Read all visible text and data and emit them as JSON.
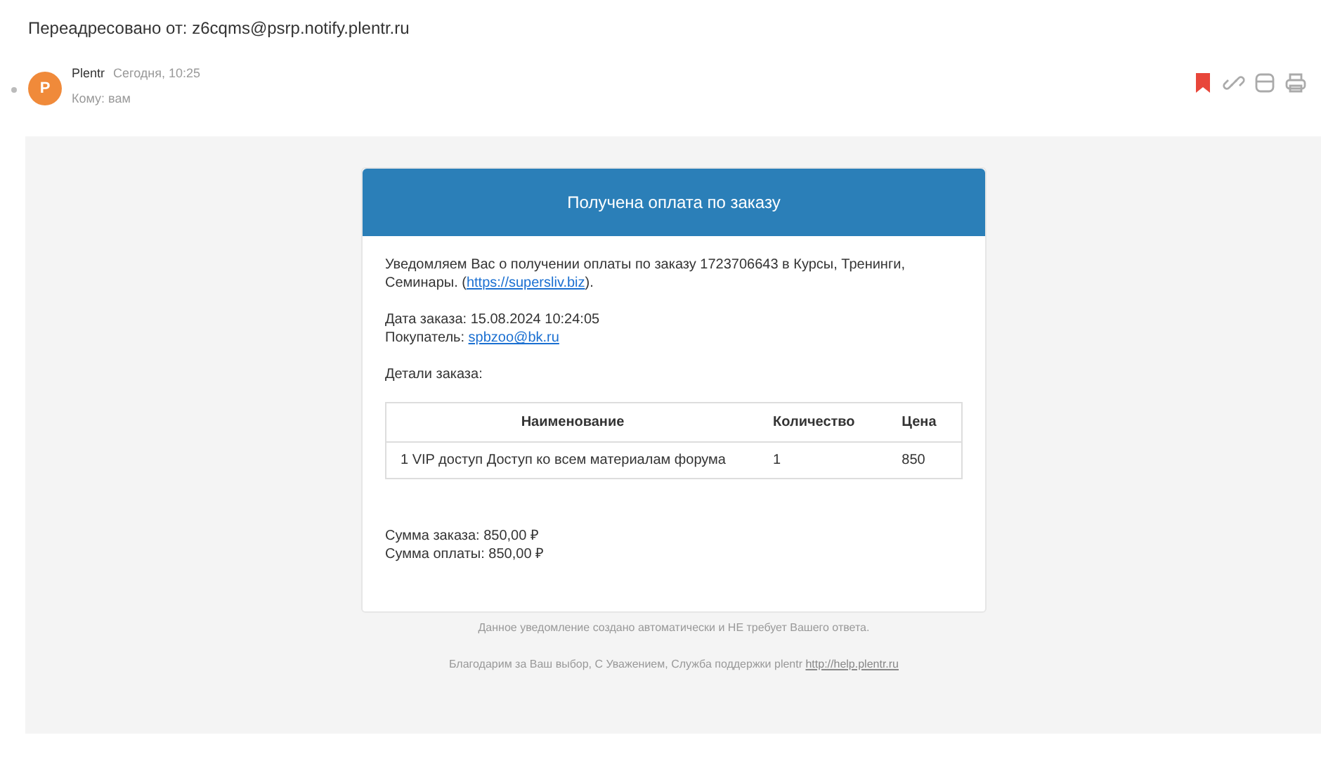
{
  "forwarded": "Переадресовано от: z6cqms@psrp.notify.plentr.ru",
  "message": {
    "avatar_letter": "P",
    "sender": "Plentr",
    "date": "Сегодня, 10:25",
    "recipient": "Кому: вам"
  },
  "card": {
    "title": "Получена оплата по заказу",
    "intro": {
      "before": "Уведомляем Вас о получении оплаты по заказу 1723706643 в Курсы, Тренинги, Семинары. (",
      "link": "https://supersliv.biz",
      "after": ")."
    },
    "order_date": "Дата заказа: 15.08.2024 10:24:05",
    "buyer": {
      "label": "Покупатель: ",
      "link": "spbzoo@bk.ru"
    },
    "details_label": "Детали заказа:",
    "table": {
      "columns": [
        "Наименование",
        "Количество",
        "Цена"
      ],
      "rows": [
        [
          "1 VIP доступ Доступ ко всем материалам форума",
          "1",
          "850"
        ]
      ]
    },
    "totals": [
      "Сумма заказа: 850,00 ₽",
      "Сумма оплаты: 850,00 ₽"
    ]
  },
  "footer": {
    "notice": "Данное уведомление создано автоматически и НЕ требует Вашего ответа.",
    "thanks": "Благодарим за Ваш выбор, С Уважением, Служба поддержки plentr ",
    "link": "http://help.plentr.ru"
  }
}
